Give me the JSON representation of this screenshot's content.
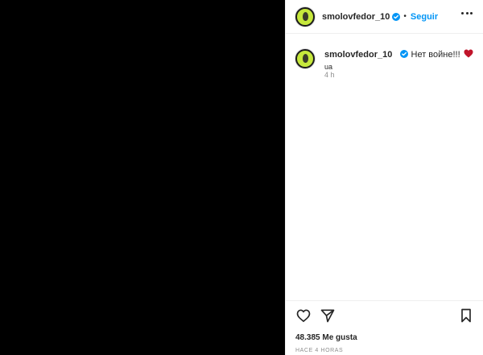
{
  "post": {
    "username": "smolovfedor_10",
    "follow_label": "Seguir",
    "separator": "•",
    "caption_text": "Нет войне!!!",
    "caption_suffix": "ua",
    "comment_time": "4 h",
    "likes": "48.385 Me gusta",
    "posted_time": "HACE 4 HORAS"
  },
  "colors": {
    "accent": "#0095f6",
    "avatar": "#c6e83c",
    "media": "#000000",
    "heart": "#c0142a"
  },
  "icons": {
    "verified": "verified-badge-icon",
    "more": "more-options-icon",
    "like": "heart-icon",
    "share": "send-icon",
    "save": "bookmark-icon",
    "heart_emoji": "red-heart-emoji"
  }
}
